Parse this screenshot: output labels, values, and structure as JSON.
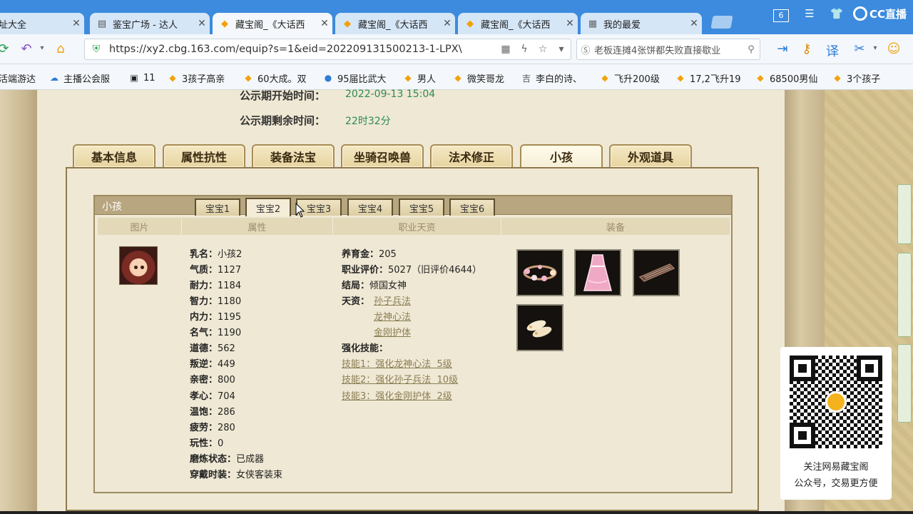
{
  "browser": {
    "tabs": [
      {
        "label": "址大全",
        "icon": "page-icon",
        "active": false
      },
      {
        "label": "鉴宝广场 - 达人",
        "icon": "page-icon",
        "active": false
      },
      {
        "label": "藏宝阁_《大话西",
        "icon": "cbg-icon",
        "active": true
      },
      {
        "label": "藏宝阁_《大话西",
        "icon": "cbg-icon",
        "active": false
      },
      {
        "label": "藏宝阁_《大话西",
        "icon": "cbg-icon",
        "active": false
      },
      {
        "label": "我的最爱",
        "icon": "grid-icon",
        "active": false
      }
    ],
    "tab_counter": "6",
    "cc_label": "CC直播",
    "url": "https://xy2.cbg.163.com/equip?s=1&eid=202209131500213-1-LPX\\",
    "search_text": "老板连摊4张饼都失败直接歇业",
    "bookmarks": [
      "活端游达",
      "主播公会服",
      "11",
      "3孩子高亲",
      "60大成。双",
      "95届比武大",
      "男人",
      "微笑哥龙",
      "李白的诗、",
      "飞升200级",
      "17,2飞升19",
      "68500男仙",
      "3个孩子"
    ]
  },
  "page": {
    "public_start_label": "公示期开始时间：",
    "public_start_value": "2022-09-13 15:04",
    "public_remaining_label": "公示期剩余时间：",
    "public_remaining_value": "22时32分",
    "main_tabs": [
      "基本信息",
      "属性抗性",
      "装备法宝",
      "坐骑召唤兽",
      "法术修正",
      "小孩",
      "外观道具"
    ],
    "selected_main_tab": "小孩",
    "panel_title": "小孩",
    "baby_tabs": [
      "宝宝1",
      "宝宝2",
      "宝宝3",
      "宝宝4",
      "宝宝5",
      "宝宝6"
    ],
    "selected_baby_tab": "宝宝2",
    "columns": [
      "图片",
      "属性",
      "职业天资",
      "装备"
    ],
    "attributes": [
      {
        "label": "乳名：",
        "value": "小孩2"
      },
      {
        "label": "气质：",
        "value": "1127"
      },
      {
        "label": "耐力：",
        "value": "1184"
      },
      {
        "label": "智力：",
        "value": "1180"
      },
      {
        "label": "内力：",
        "value": "1195"
      },
      {
        "label": "名气：",
        "value": "1190"
      },
      {
        "label": "道德：",
        "value": "562"
      },
      {
        "label": "叛逆：",
        "value": "449"
      },
      {
        "label": "亲密：",
        "value": "800"
      },
      {
        "label": "孝心：",
        "value": "704"
      },
      {
        "label": "温饱：",
        "value": "286"
      },
      {
        "label": "疲劳：",
        "value": "280"
      },
      {
        "label": "玩性：",
        "value": "0"
      },
      {
        "label": "磨炼状态：",
        "value": "已成器"
      },
      {
        "label": "穿戴时装：",
        "value": "女侠客装束"
      }
    ],
    "profession": {
      "fund_label": "养育金：",
      "fund_value": "205",
      "rating_label": "职业评价：",
      "rating_value": "5027（旧评价4644）",
      "ending_label": "结局：",
      "ending_value": "倾国女神",
      "talent_label": "天资：",
      "talents": [
        "孙子兵法",
        "龙神心法",
        "金刚护体"
      ],
      "skills_label": "强化技能：",
      "skills": [
        "技能1：强化龙神心法  5级",
        "技能2：强化孙子兵法  10级",
        "技能3：强化金刚护体  2级"
      ]
    },
    "equipment_icons": [
      "flower-crown-icon",
      "pink-dress-icon",
      "guqin-icon",
      "shoes-icon"
    ],
    "qr_text_line1": "关注网易藏宝阁",
    "qr_text_line2": "公众号，交易更方便"
  }
}
